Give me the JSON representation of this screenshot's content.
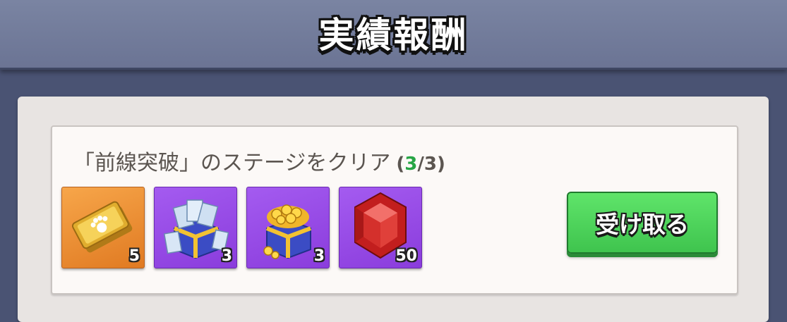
{
  "header": {
    "title": "実績報酬"
  },
  "achievement": {
    "mission_text": "「前線突破」のステージをクリア",
    "progress_open": "(",
    "progress_current": "3",
    "progress_sep": "/",
    "progress_total": "3",
    "progress_close": ")",
    "rewards": [
      {
        "icon": "gold-pet-ticket-icon",
        "count": "5"
      },
      {
        "icon": "exp-ticket-chest-icon",
        "count": "3"
      },
      {
        "icon": "gold-coin-chest-icon",
        "count": "3"
      },
      {
        "icon": "red-gem-icon",
        "count": "50"
      }
    ],
    "claim_label": "受け取る"
  },
  "colors": {
    "background": "#4a5373",
    "header": "#7a84a2",
    "progress_current": "#27a545",
    "claim_button": "#4fd45c"
  }
}
